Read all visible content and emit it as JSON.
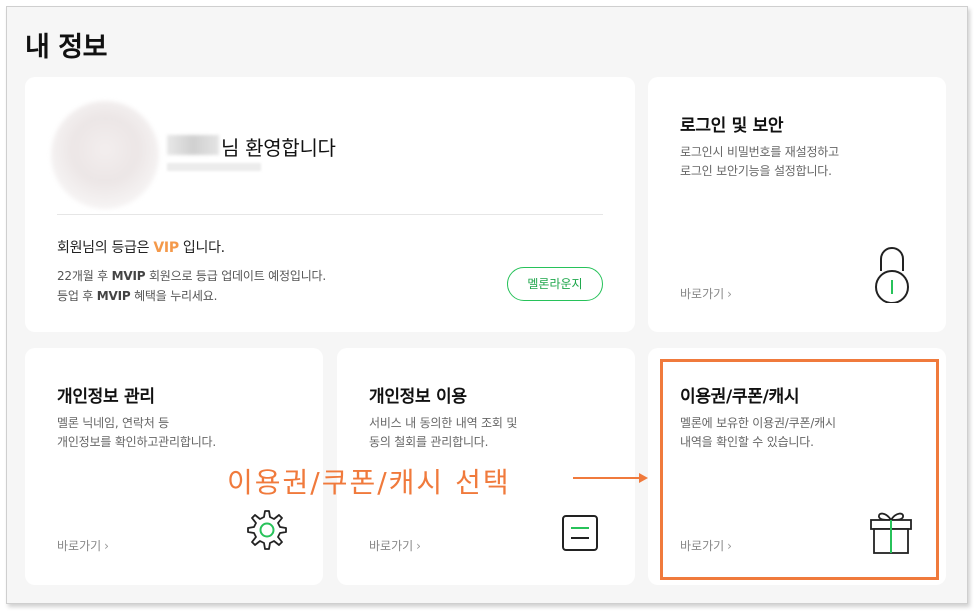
{
  "page": {
    "title": "내 정보"
  },
  "profile": {
    "welcome": "님 환영합니다",
    "grade_prefix": "회원님의 등급은 ",
    "grade": "VIP",
    "grade_suffix": " 입니다.",
    "line1_prefix": "22개월 후 ",
    "line1_grade": "MVIP",
    "line1_suffix": " 회원으로 등급 업데이트 예정입니다.",
    "line2_prefix": "등업 후 ",
    "line2_grade": "MVIP",
    "line2_suffix": " 혜택을 누리세요.",
    "lounge_button": "멜론라운지"
  },
  "cards": {
    "login_security": {
      "title": "로그인 및 보안",
      "desc1": "로그인시 비밀번호를 재설정하고",
      "desc2": "로그인 보안기능을 설정합니다.",
      "goto": "바로가기",
      "icon": "padlock-icon"
    },
    "personal_manage": {
      "title": "개인정보 관리",
      "desc1": "멜론 닉네임, 연락처 등",
      "desc2": "개인정보를 확인하고관리합니다.",
      "goto": "바로가기",
      "icon": "gear-icon"
    },
    "personal_use": {
      "title": "개인정보 이용",
      "desc1": "서비스 내 동의한 내역 조회 및",
      "desc2": "동의 철회를 관리합니다.",
      "goto": "바로가기",
      "icon": "document-icon"
    },
    "voucher": {
      "title": "이용권/쿠폰/캐시",
      "desc1": "멜론에 보유한 이용권/쿠폰/캐시",
      "desc2": "내역을 확인할 수 있습니다.",
      "goto": "바로가기",
      "icon": "gift-icon"
    }
  },
  "annotation": {
    "text": "이용권/쿠폰/캐시 선택",
    "color": "#f07a3c"
  },
  "colors": {
    "accent_green": "#27c25a",
    "grade_orange": "#f4994a",
    "background": "#f6f6f6"
  }
}
